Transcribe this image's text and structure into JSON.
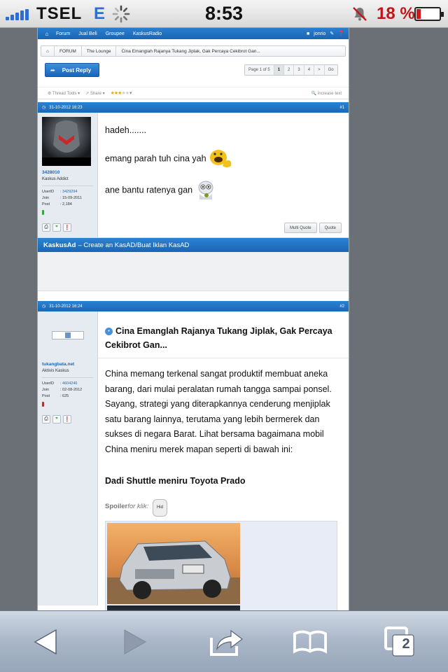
{
  "status_bar": {
    "carrier": "TSEL",
    "network": "E",
    "time": "8:53",
    "battery_percent": "18 %",
    "battery_level": 0.18
  },
  "forum_nav": {
    "items": [
      "Forum",
      "Jual Beli",
      "Groupee",
      "KaskusRadio"
    ],
    "username": "jonrio"
  },
  "breadcrumb": [
    "FORUM",
    "The Lounge",
    "Cina Emanglah Rajanya Tukang Jiplak, Gak Percaya Cekibrot Gan..."
  ],
  "toolbar": {
    "post_reply": "Post Reply",
    "pagination": [
      "Page 1 of 5",
      "1",
      "2",
      "3",
      "4",
      ">",
      "Go"
    ],
    "current_page": "1",
    "thread_tools": "Thread Tools",
    "share": "Share",
    "rating_stars": 3,
    "increase_text": "increase text"
  },
  "post1": {
    "date": "31-10-2012 16:23",
    "number": "#1",
    "username": "3428010",
    "user_title": "Kaskus Addict",
    "stats": [
      {
        "label": "UserID",
        "value": ": 3429294"
      },
      {
        "label": "Join",
        "value": ": 15-09-2011"
      },
      {
        "label": "Post",
        "value": ": 2,184"
      }
    ],
    "reputation_color": "#3ba53b",
    "lines": [
      "hadeh.......",
      "emang parah tuh cina yah",
      "ane bantu ratenya gan"
    ],
    "multi_quote": "Multi Quote",
    "quote": "Quote"
  },
  "kaskus_ad": {
    "brand": "KaskusAd",
    "text": "– Create an KasAD/Buat Iklan KasAD"
  },
  "post2": {
    "date": "31-10-2012 16:24",
    "number": "#2",
    "username": "tukangbata.net",
    "user_title": "Aktivis Kaskus",
    "stats": [
      {
        "label": "UserID",
        "value": ": 4604246"
      },
      {
        "label": "Join",
        "value": ": 02-08-2012"
      },
      {
        "label": "Post",
        "value": ": 625"
      }
    ],
    "reputation_color": "#a33a2e",
    "title": "Cina Emanglah Rajanya Tukang Jiplak, Gak Percaya Cekibrot Gan...",
    "body": "China memang terkenal sangat produktif membuat aneka barang, dari mulai peralatan rumah tangga sampai ponsel. Sayang, strategi yang diterapkannya cenderung menjiplak satu barang lainnya, terutama yang lebih bermerek dan sukses di negara Barat. Lihat bersama bagaimana mobil China meniru merek mapan seperti di bawah ini:",
    "subheading": "Dadi Shuttle meniru Toyota Prado",
    "spoiler_label": "Spoiler",
    "spoiler_for": "for klik:",
    "spoiler_button": "Hid"
  },
  "safari_toolbar": {
    "tab_count": "2"
  }
}
